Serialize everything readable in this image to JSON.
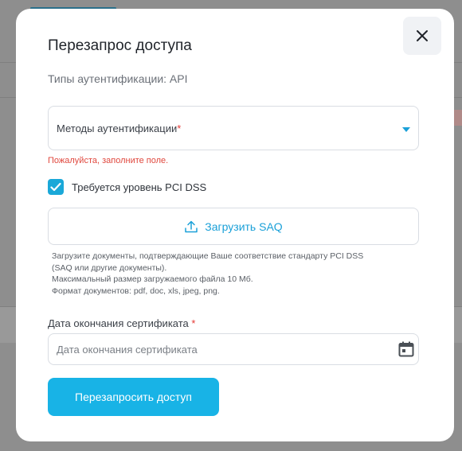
{
  "modal": {
    "title": "Перезапрос доступа",
    "auth_types_text": "Типы аутентификации: API",
    "auth_methods": {
      "label": "Методы аутентификации",
      "required_mark": "*",
      "error": "Пожалуйста, заполните поле."
    },
    "pci_dss": {
      "label": "Требуется уровень PCI DSS",
      "checked": true
    },
    "upload": {
      "label": "Загрузить SAQ",
      "hint_lines": [
        "Загрузите документы, подтверждающие Ваше соответствие стандарту PCI DSS",
        "(SAQ или другие документы).",
        "Максимальный размер загружаемого файла 10 Мб.",
        "Формат документов: pdf, doc, xls, jpeg, png."
      ]
    },
    "cert_date": {
      "label": "Дата окончания сертификата",
      "required_mark": "*",
      "placeholder": "Дата окончания сертификата"
    },
    "submit_label": "Перезапросить доступ"
  },
  "colors": {
    "accent": "#18b3e6",
    "error": "#e0483e",
    "overlay": "#8e8e8e"
  }
}
